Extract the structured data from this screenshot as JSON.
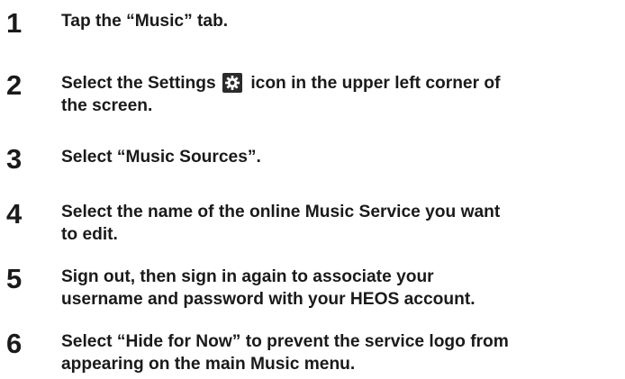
{
  "steps": [
    {
      "number": "1",
      "lines": [
        "Tap the “Music” tab."
      ]
    },
    {
      "number": "2",
      "line1_before": "Select the Settings ",
      "icon": "gear-icon",
      "line1_after": " icon in the upper left corner of",
      "line2": "the screen."
    },
    {
      "number": "3",
      "lines": [
        "Select “Music Sources”."
      ]
    },
    {
      "number": "4",
      "lines": [
        "Select the name of the online Music Service you want",
        "to edit."
      ]
    },
    {
      "number": "5",
      "lines": [
        "Sign out, then sign in again to associate your",
        "username and password with your HEOS account."
      ]
    },
    {
      "number": "6",
      "lines": [
        "Select “Hide for Now” to prevent the service logo from",
        "appearing on the main Music menu."
      ]
    }
  ]
}
